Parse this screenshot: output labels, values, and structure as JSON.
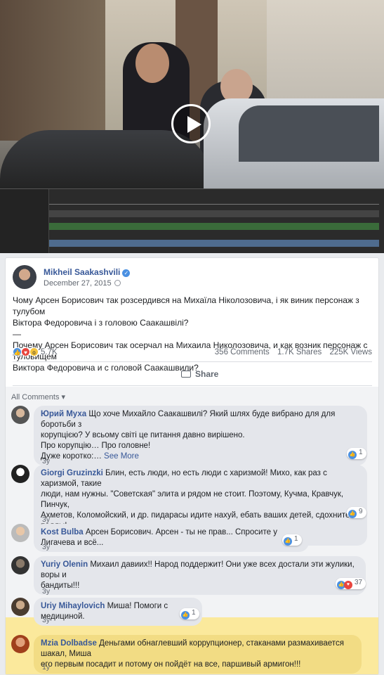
{
  "post": {
    "author": "Mikheil Saakashvili",
    "date": "December 27, 2015",
    "text_ua_line1": "Чому Арсен Борисович так розсердився на Михаїла Ніколозовича, і як виник персонаж з тулубом",
    "text_ua_line2": "Віктора Федоровича і з головою Саакашвілі?",
    "separator": "—",
    "text_ru_line1": "Почему Арсен Борисович так осерчал на Михаила Николозовича, и как возник персонаж с туловищем",
    "text_ru_line2": "Виктора Федоровича и с головой Саакашвили?",
    "reaction_count": "5.7K",
    "comments_count": "356 Comments",
    "shares_count": "1.7K Shares",
    "views_count": "225K Views",
    "share_label": "Share"
  },
  "comments_header": "All Comments ▾",
  "comments": [
    {
      "name": "Юрий Муха",
      "line1": "Що хоче Михайло Саакашвилі? Який шлях буде вибрано для для боротьби з",
      "line2": "корупцією? У всьому світі це питання давно вирішено.",
      "line3": "Про корупцію… Про головне!",
      "line4": "Дуже коротко:…",
      "see_more": "See More",
      "age": "3y",
      "reactions": "1"
    },
    {
      "name": "Giorgi Gruzinzki",
      "line1": "Блин, есть люди, но есть люди с харизмой! Михо, как раз с харизмой, такие",
      "line2": "люди, нам нужны. \"Советская\" элита и рядом не стоит. Поэтому, Кучма, Кравчук, Пинчук,",
      "line3": "Ахметов, Коломойский, и др. пидарасы идите нахуй, ебать ваших детей, сдохните падлы!",
      "line4": "Система говна Украине не нужна!",
      "age": "3y",
      "reactions": "9"
    },
    {
      "name": "Kost Bulba",
      "line1": "Арсен Борисович. Арсен - ты не прав... Спросите у Лигачева и всё...",
      "age": "3y",
      "reactions": "1"
    },
    {
      "name": "Yuriy Olenin",
      "line1": "Михаил давиих!! Народ поддержит! Они уже всех достали эти жулики, воры и",
      "line2": "бандиты!!!",
      "age": "3y",
      "reactions": "37"
    },
    {
      "name": "Uriy Mihaylovich",
      "line1": "Миша! Помоги с медициной.",
      "age": "3y",
      "reactions": "1"
    },
    {
      "name": "Mzia Dolbadse",
      "line1": "Деньгами обнаглевший коррупционер, стаканами размахивается шакал, Миша",
      "line2": "его первым посадит и потому он пойдёт на все, паршивый армигон!!!",
      "age": "1y"
    }
  ],
  "colors": {
    "link": "#385898",
    "highlight": "#fbe99c",
    "like": "#4a90e2",
    "love": "#e9463f"
  }
}
